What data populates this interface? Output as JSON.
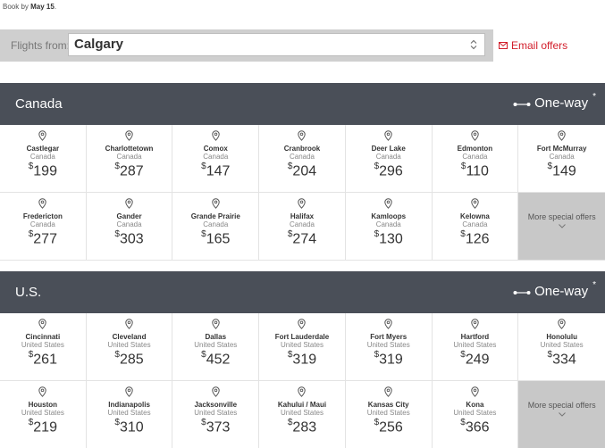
{
  "book_by": {
    "prefix": "Book by ",
    "date": "May 15",
    "suffix": "."
  },
  "search": {
    "label": "Flights from:",
    "value": "Calgary"
  },
  "email_offers": {
    "label": "Email offers"
  },
  "colors": {
    "header_bg": "#4a4f58",
    "accent": "#d21e2b",
    "more_bg": "#c8c8c8"
  },
  "sections": [
    {
      "title": "Canada",
      "one_way": "One-way",
      "asterisk": "*",
      "more_label": "More special offers",
      "destinations": [
        {
          "city": "Castlegar",
          "country": "Canada",
          "price": "199"
        },
        {
          "city": "Charlottetown",
          "country": "Canada",
          "price": "287"
        },
        {
          "city": "Comox",
          "country": "Canada",
          "price": "147"
        },
        {
          "city": "Cranbrook",
          "country": "Canada",
          "price": "204"
        },
        {
          "city": "Deer Lake",
          "country": "Canada",
          "price": "296"
        },
        {
          "city": "Edmonton",
          "country": "Canada",
          "price": "110"
        },
        {
          "city": "Fort McMurray",
          "country": "Canada",
          "price": "149"
        },
        {
          "city": "Fredericton",
          "country": "Canada",
          "price": "277"
        },
        {
          "city": "Gander",
          "country": "Canada",
          "price": "303"
        },
        {
          "city": "Grande Prairie",
          "country": "Canada",
          "price": "165"
        },
        {
          "city": "Halifax",
          "country": "Canada",
          "price": "274"
        },
        {
          "city": "Kamloops",
          "country": "Canada",
          "price": "130"
        },
        {
          "city": "Kelowna",
          "country": "Canada",
          "price": "126"
        }
      ]
    },
    {
      "title": "U.S.",
      "one_way": "One-way",
      "asterisk": "*",
      "more_label": "More special offers",
      "destinations": [
        {
          "city": "Cincinnati",
          "country": "United States",
          "price": "261"
        },
        {
          "city": "Cleveland",
          "country": "United States",
          "price": "285"
        },
        {
          "city": "Dallas",
          "country": "United States",
          "price": "452"
        },
        {
          "city": "Fort Lauderdale",
          "country": "United States",
          "price": "319"
        },
        {
          "city": "Fort Myers",
          "country": "United States",
          "price": "319"
        },
        {
          "city": "Hartford",
          "country": "United States",
          "price": "249"
        },
        {
          "city": "Honolulu",
          "country": "United States",
          "price": "334"
        },
        {
          "city": "Houston",
          "country": "United States",
          "price": "219"
        },
        {
          "city": "Indianapolis",
          "country": "United States",
          "price": "310"
        },
        {
          "city": "Jacksonville",
          "country": "United States",
          "price": "373"
        },
        {
          "city": "Kahului / Maui",
          "country": "United States",
          "price": "283"
        },
        {
          "city": "Kansas City",
          "country": "United States",
          "price": "256"
        },
        {
          "city": "Kona",
          "country": "United States",
          "price": "366"
        }
      ]
    }
  ],
  "currency_symbol": "$"
}
